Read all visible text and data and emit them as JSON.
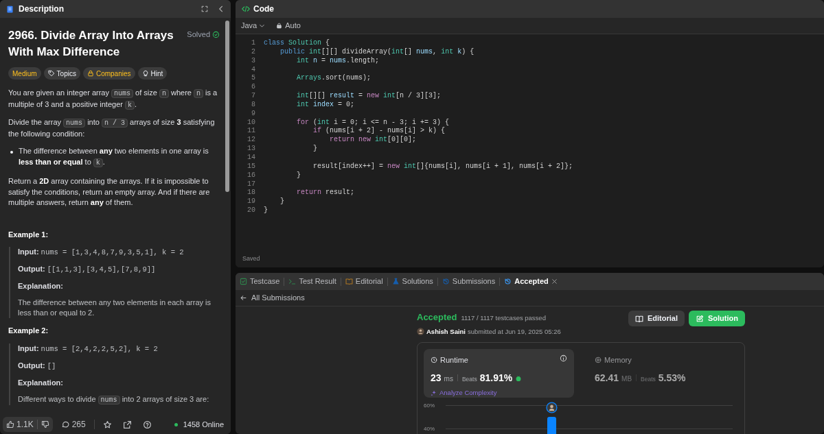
{
  "description": {
    "tab_title": "Description",
    "title": "2966. Divide Array Into Arrays With Max Difference",
    "solved": {
      "label": "Solved",
      "on": true
    },
    "tags": [
      {
        "label": "Medium",
        "kind": "difficulty"
      },
      {
        "label": "Topics",
        "kind": "topics"
      },
      {
        "label": "Companies",
        "kind": "companies"
      },
      {
        "label": "Hint",
        "kind": "hint"
      }
    ],
    "blocks": [
      {
        "kind": "paragraph",
        "parts": [
          {
            "text": "You are given an integer array ",
            "kind": "text"
          },
          {
            "text": "nums",
            "kind": "code"
          },
          {
            "text": " of size ",
            "kind": "text"
          },
          {
            "text": "n",
            "kind": "code"
          },
          {
            "text": " where ",
            "kind": "text"
          },
          {
            "text": "n",
            "kind": "code"
          },
          {
            "text": " is a multiple of 3 and a positive integer ",
            "kind": "text"
          },
          {
            "text": "k",
            "kind": "code"
          },
          {
            "text": ".",
            "kind": "text"
          }
        ]
      },
      {
        "kind": "paragraph",
        "parts": [
          {
            "text": "Divide the array ",
            "kind": "text"
          },
          {
            "text": "nums",
            "kind": "code"
          },
          {
            "text": " into ",
            "kind": "text"
          },
          {
            "text": "n / 3",
            "kind": "code"
          },
          {
            "text": " arrays of size ",
            "kind": "text"
          },
          {
            "text": "3",
            "kind": "bold"
          },
          {
            "text": " satisfying the following condition:",
            "kind": "text"
          }
        ]
      },
      {
        "kind": "bullet",
        "parts": [
          {
            "text": "The difference between ",
            "kind": "text"
          },
          {
            "text": "any",
            "kind": "bold"
          },
          {
            "text": " two elements in one array is ",
            "kind": "text"
          },
          {
            "text": "less than or equal",
            "kind": "bold"
          },
          {
            "text": " to ",
            "kind": "text"
          },
          {
            "text": "k",
            "kind": "code"
          },
          {
            "text": ".",
            "kind": "text"
          }
        ]
      },
      {
        "kind": "paragraph",
        "parts": [
          {
            "text": "Return a ",
            "kind": "text"
          },
          {
            "text": "2D",
            "kind": "bold"
          },
          {
            "text": " array containing the arrays. If it is impossible to satisfy the conditions, return an empty array. And if there are multiple answers, return ",
            "kind": "text"
          },
          {
            "text": "any",
            "kind": "bold"
          },
          {
            "text": " of them.",
            "kind": "text"
          }
        ]
      }
    ],
    "examples": [
      {
        "title": "Example 1:",
        "input_label": "Input:",
        "input": "nums = [1,3,4,8,7,9,3,5,1], k = 2",
        "output_label": "Output:",
        "output": "[[1,1,3],[3,4,5],[7,8,9]]",
        "explanation_label": "Explanation:",
        "explanation": [
          {
            "text": "The difference between any two elements in each array is less than or equal to 2.",
            "kind": "text"
          }
        ]
      },
      {
        "title": "Example 2:",
        "input_label": "Input:",
        "input": "nums = [2,4,2,2,5,2], k = 2",
        "output_label": "Output:",
        "output": "[]",
        "explanation_label": "Explanation:",
        "explanation": [
          {
            "text": "Different ways to divide ",
            "kind": "text"
          },
          {
            "text": "nums",
            "kind": "code"
          },
          {
            "text": " into 2 arrays of size 3 are:",
            "kind": "text"
          }
        ]
      }
    ],
    "footer": {
      "likes": "1.1K",
      "comments": "265",
      "online": "1458 Online"
    }
  },
  "code": {
    "tab_title": "Code",
    "language": "Java",
    "mode": "Auto",
    "status": "Saved",
    "lines": [
      {
        "number": "1",
        "tokens": [
          {
            "text": "class ",
            "kind": "keyword"
          },
          {
            "text": "Solution",
            "kind": "type"
          },
          {
            "text": " {",
            "kind": "plain"
          }
        ]
      },
      {
        "number": "2",
        "tokens": [
          {
            "text": "    public ",
            "kind": "keyword"
          },
          {
            "text": "int",
            "kind": "type"
          },
          {
            "text": "[][] divideArray(",
            "kind": "plain"
          },
          {
            "text": "int",
            "kind": "type"
          },
          {
            "text": "[] ",
            "kind": "plain"
          },
          {
            "text": "nums",
            "kind": "var"
          },
          {
            "text": ", ",
            "kind": "plain"
          },
          {
            "text": "int ",
            "kind": "type"
          },
          {
            "text": "k",
            "kind": "var"
          },
          {
            "text": ") {",
            "kind": "plain"
          }
        ]
      },
      {
        "number": "3",
        "tokens": [
          {
            "text": "        int ",
            "kind": "type"
          },
          {
            "text": "n",
            "kind": "var"
          },
          {
            "text": " = ",
            "kind": "plain"
          },
          {
            "text": "nums",
            "kind": "var"
          },
          {
            "text": ".length;",
            "kind": "plain"
          }
        ]
      },
      {
        "number": "4"
      },
      {
        "number": "5",
        "tokens": [
          {
            "text": "        Arrays",
            "kind": "type"
          },
          {
            "text": ".sort(nums);",
            "kind": "plain"
          }
        ]
      },
      {
        "number": "6"
      },
      {
        "number": "7",
        "tokens": [
          {
            "text": "        int",
            "kind": "type"
          },
          {
            "text": "[][] ",
            "kind": "plain"
          },
          {
            "text": "result",
            "kind": "var"
          },
          {
            "text": " = ",
            "kind": "plain"
          },
          {
            "text": "new ",
            "kind": "control"
          },
          {
            "text": "int",
            "kind": "type"
          },
          {
            "text": "[n / 3][3];",
            "kind": "plain"
          }
        ]
      },
      {
        "number": "8",
        "tokens": [
          {
            "text": "        int ",
            "kind": "type"
          },
          {
            "text": "index",
            "kind": "var"
          },
          {
            "text": " = 0;",
            "kind": "plain"
          }
        ]
      },
      {
        "number": "9"
      },
      {
        "number": "10",
        "tokens": [
          {
            "text": "        for ",
            "kind": "control"
          },
          {
            "text": "(",
            "kind": "plain"
          },
          {
            "text": "int ",
            "kind": "type"
          },
          {
            "text": "i = 0; i <= n - 3; i += 3) {",
            "kind": "plain"
          }
        ]
      },
      {
        "number": "11",
        "tokens": [
          {
            "text": "            if ",
            "kind": "control"
          },
          {
            "text": "(nums[i + 2] - nums[i] > k) {",
            "kind": "plain"
          }
        ]
      },
      {
        "number": "12",
        "tokens": [
          {
            "text": "                return new ",
            "kind": "control"
          },
          {
            "text": "int",
            "kind": "type"
          },
          {
            "text": "[0][0];",
            "kind": "plain"
          }
        ]
      },
      {
        "number": "13",
        "tokens": [
          {
            "text": "            }",
            "kind": "plain"
          }
        ]
      },
      {
        "number": "14"
      },
      {
        "number": "15",
        "tokens": [
          {
            "text": "            result[index++] = ",
            "kind": "plain"
          },
          {
            "text": "new ",
            "kind": "control"
          },
          {
            "text": "int",
            "kind": "type"
          },
          {
            "text": "[]{nums[i], nums[i + 1], nums[i + 2]};",
            "kind": "plain"
          }
        ]
      },
      {
        "number": "16",
        "tokens": [
          {
            "text": "        }",
            "kind": "plain"
          }
        ]
      },
      {
        "number": "17"
      },
      {
        "number": "18",
        "tokens": [
          {
            "text": "        return ",
            "kind": "control"
          },
          {
            "text": "result;",
            "kind": "plain"
          }
        ]
      },
      {
        "number": "19",
        "tokens": [
          {
            "text": "    }",
            "kind": "plain"
          }
        ]
      },
      {
        "number": "20",
        "tokens": [
          {
            "text": "}",
            "kind": "plain"
          }
        ]
      }
    ]
  },
  "bottom_panel": {
    "tabs": [
      {
        "label": "Testcase",
        "selected": false
      },
      {
        "label": "Test Result",
        "selected": false
      },
      {
        "label": "Editorial",
        "selected": false
      },
      {
        "label": "Solutions",
        "selected": false
      },
      {
        "label": "Submissions",
        "selected": false
      },
      {
        "label": "Accepted",
        "selected": true
      }
    ],
    "back_link": "All Submissions",
    "result": {
      "status": "Accepted",
      "testcases": "1117 / 1117 testcases passed",
      "user": "Ashish Saini",
      "submitted": "submitted at Jun 19, 2025 05:26",
      "buttons": [
        {
          "label": "Editorial",
          "kind": "secondary"
        },
        {
          "label": "Solution",
          "kind": "primary"
        }
      ],
      "stats": [
        {
          "label": "Runtime",
          "value": "23",
          "unit": "ms",
          "beats_label": "Beats",
          "beats": "81.91%",
          "link": "Analyze Complexity",
          "selected": true
        },
        {
          "label": "Memory",
          "value": "62.41",
          "unit": "MB",
          "beats_label": "Beats",
          "beats": "5.53%",
          "selected": false
        }
      ],
      "chart_ticks": [
        "60%",
        "40%"
      ]
    }
  }
}
